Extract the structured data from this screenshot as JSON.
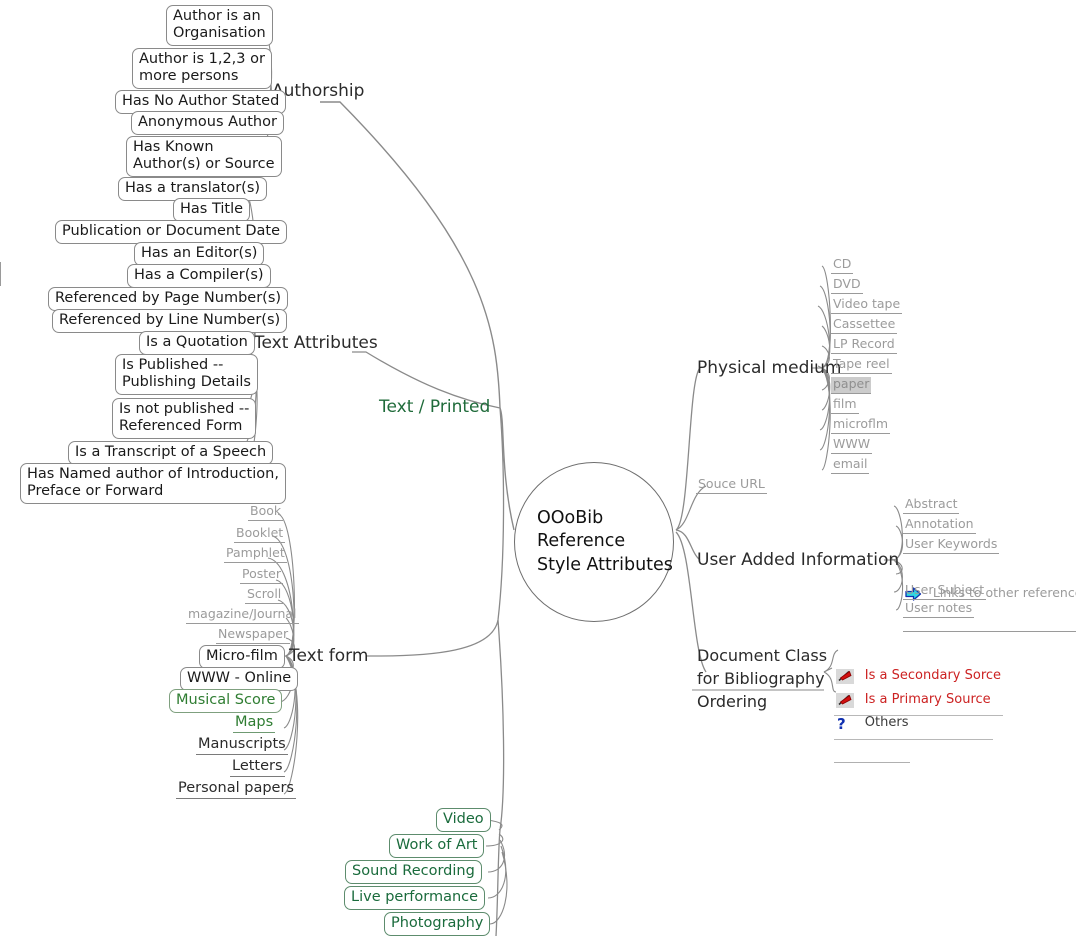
{
  "center": {
    "label": "OOoBib\nReference\nStyle Attributes"
  },
  "branches": {
    "authorship": {
      "label": "Authorship",
      "children": [
        {
          "label": "Author is an\nOrganisation",
          "style": "boxed"
        },
        {
          "label": "Author is 1,2,3 or\nmore persons",
          "style": "boxed"
        },
        {
          "label": "Has No Author Stated",
          "style": "boxed"
        },
        {
          "label": "Anonymous Author",
          "style": "boxed"
        },
        {
          "label": "Has Known\nAuthor(s) or Source",
          "style": "boxed"
        }
      ]
    },
    "text_attributes": {
      "label": "Text Attributes",
      "children": [
        {
          "label": "Has a translator(s)",
          "style": "boxed"
        },
        {
          "label": "Has Title",
          "style": "boxed"
        },
        {
          "label": "Publication or Document Date",
          "style": "boxed"
        },
        {
          "label": "Has an Editor(s)",
          "style": "boxed"
        },
        {
          "label": "Has a Compiler(s)",
          "style": "boxed"
        },
        {
          "label": "Referenced by Page Number(s)",
          "style": "boxed"
        },
        {
          "label": "Referenced by Line Number(s)",
          "style": "boxed"
        },
        {
          "label": "Is a Quotation",
          "style": "boxed"
        },
        {
          "label": "Is Published --\nPublishing Details",
          "style": "boxed"
        },
        {
          "label": "Is not published --\nReferenced Form",
          "style": "boxed"
        },
        {
          "label": "Is a Transcript of a Speech",
          "style": "boxed"
        },
        {
          "label": "Has Named author of Introduction,\nPreface or Forward",
          "style": "boxed"
        }
      ]
    },
    "text_printed": {
      "label": "Text / Printed",
      "color": "#1f6b3a"
    },
    "text_form": {
      "label": "Text form",
      "children": [
        {
          "label": "Book",
          "style": "underlined-gray"
        },
        {
          "label": "Booklet",
          "style": "underlined-gray"
        },
        {
          "label": "Pamphlet",
          "style": "underlined-gray"
        },
        {
          "label": "Poster",
          "style": "underlined-gray"
        },
        {
          "label": "Scroll",
          "style": "underlined-gray"
        },
        {
          "label": "magazine/Journal",
          "style": "underlined-gray"
        },
        {
          "label": "Newspaper",
          "style": "underlined-gray"
        },
        {
          "label": "Micro-film",
          "style": "boxed"
        },
        {
          "label": "WWW - Online",
          "style": "boxed"
        },
        {
          "label": "Musical Score",
          "style": "boxed-green"
        },
        {
          "label": "Maps",
          "style": "underlined-green"
        },
        {
          "label": "Manuscripts",
          "style": "underlined-dark"
        },
        {
          "label": "Letters",
          "style": "underlined-dark"
        },
        {
          "label": "Personal papers",
          "style": "underlined-dark"
        }
      ]
    },
    "media_types": {
      "children": [
        {
          "label": "Video",
          "style": "boxed-greendark"
        },
        {
          "label": "Work of Art",
          "style": "boxed-greendark"
        },
        {
          "label": "Sound Recording",
          "style": "boxed-greendark"
        },
        {
          "label": "Live performance",
          "style": "boxed-greendark"
        },
        {
          "label": "Photography",
          "style": "boxed-greendark"
        }
      ]
    },
    "physical_medium": {
      "label": "Physical medium",
      "children": [
        {
          "label": "CD",
          "style": "underlined-gray"
        },
        {
          "label": "DVD",
          "style": "underlined-gray"
        },
        {
          "label": "Video tape",
          "style": "underlined-gray"
        },
        {
          "label": "Cassettee",
          "style": "underlined-gray"
        },
        {
          "label": "LP Record",
          "style": "underlined-gray"
        },
        {
          "label": "Tape reel",
          "style": "underlined-gray"
        },
        {
          "label": "paper",
          "style": "underlined-selected"
        },
        {
          "label": "film",
          "style": "underlined-gray"
        },
        {
          "label": "microflm",
          "style": "underlined-gray"
        },
        {
          "label": "WWW",
          "style": "underlined-gray"
        },
        {
          "label": "email",
          "style": "underlined-gray"
        }
      ]
    },
    "souce_url": {
      "label": "Souce URL",
      "style": "underlined-gray"
    },
    "user_added_information": {
      "label": "User Added Information",
      "children": [
        {
          "label": "Abstract",
          "style": "underlined-gray",
          "icon": null
        },
        {
          "label": "Annotation",
          "style": "underlined-gray",
          "icon": null
        },
        {
          "label": "User Keywords",
          "style": "underlined-gray",
          "icon": null
        },
        {
          "label": "Links to other references",
          "style": "underlined-gray",
          "icon": "right-arrow-icon"
        },
        {
          "label": "User Subject",
          "style": "underlined-gray",
          "icon": null
        },
        {
          "label": "User notes",
          "style": "underlined-gray",
          "icon": null
        }
      ]
    },
    "document_class": {
      "label": "Document Class\nfor Bibliography\nOrdering",
      "children": [
        {
          "label": "Is a Secondary Sorce",
          "style": "underlined-red",
          "icon": "red-flag-icon"
        },
        {
          "label": "Is a Primary Source",
          "style": "underlined-red",
          "icon": "red-flag-icon"
        },
        {
          "label": "Others",
          "style": "underlined-blackish",
          "icon": "question-mark-icon"
        }
      ]
    }
  },
  "colors": {
    "link": "#8a8a8a",
    "green": "#2f7d32",
    "green_dark": "#1a6b3c",
    "gray_text": "#9b9b9b",
    "red": "#cc2222",
    "arrow_cyan": "#2fd8e0",
    "arrow_blue": "#1030b0",
    "selected_bg": "#cccccc"
  }
}
